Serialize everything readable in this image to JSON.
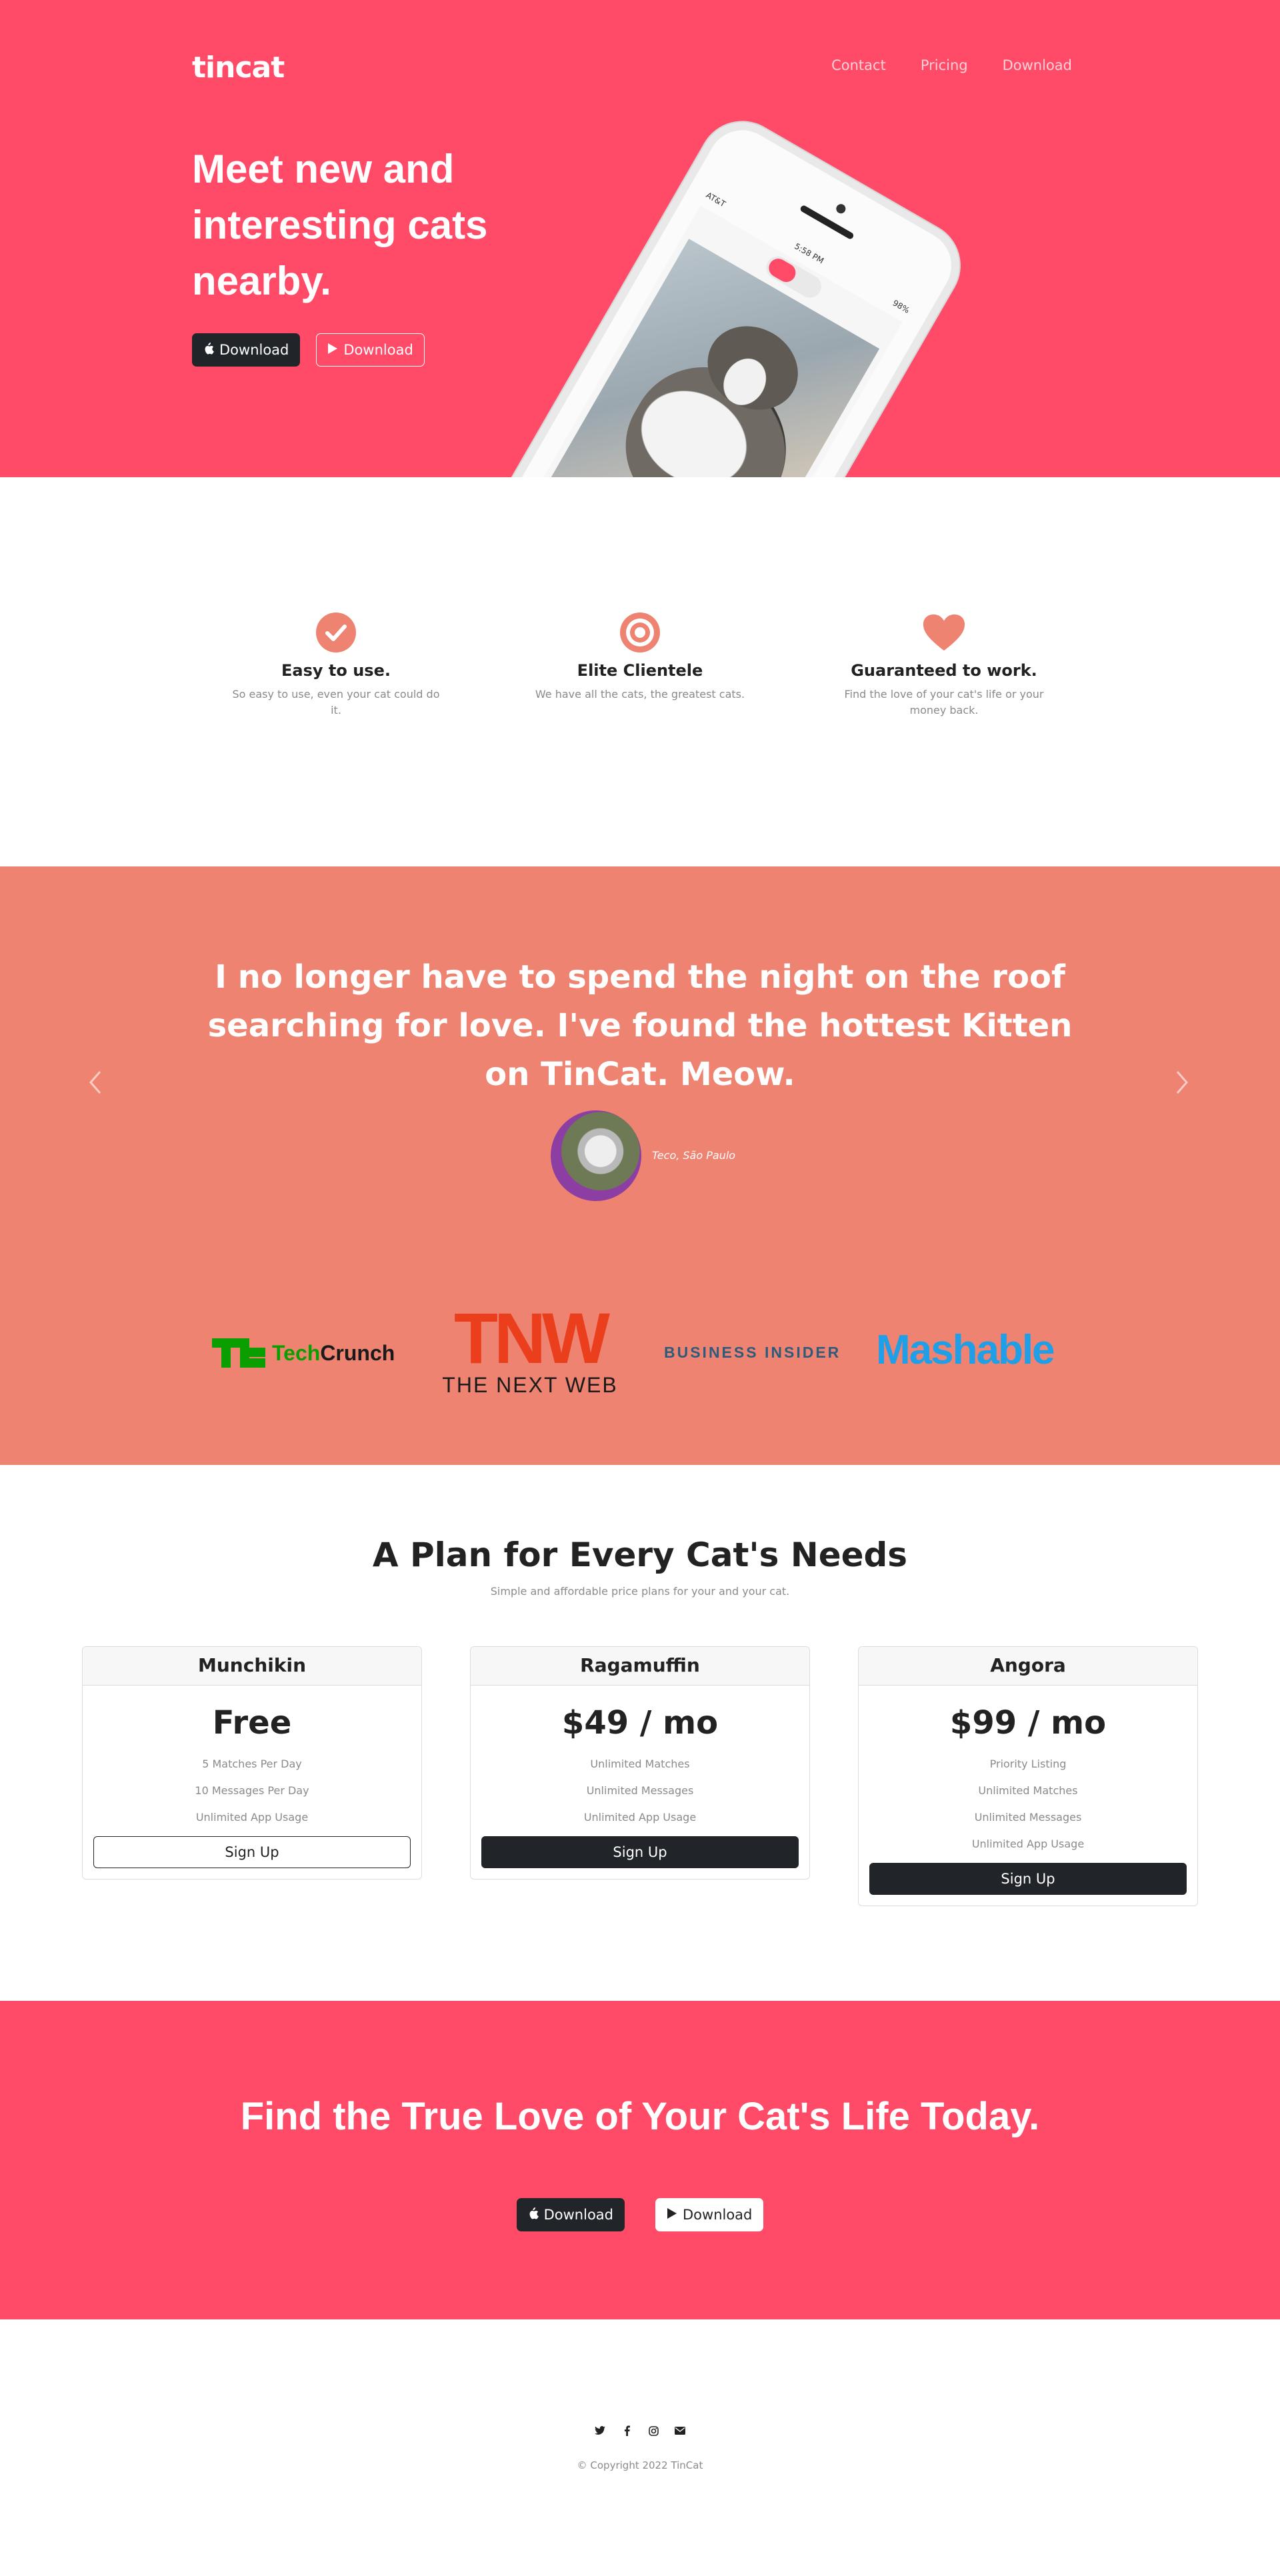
{
  "brand": "tincat",
  "nav": [
    "Contact",
    "Pricing",
    "Download"
  ],
  "hero": {
    "title": "Meet new and interesting cats nearby.",
    "buttons": [
      "Download",
      "Download"
    ]
  },
  "phone": {
    "carrier": "AT&T",
    "time": "5:58 PM",
    "battery": "98%"
  },
  "features": [
    {
      "icon": "check-circle-icon",
      "title": "Easy to use.",
      "text": "So easy to use, even your cat could do it."
    },
    {
      "icon": "target-icon",
      "title": "Elite Clientele",
      "text": "We have all the cats, the greatest cats."
    },
    {
      "icon": "heart-icon",
      "title": "Guaranteed to work.",
      "text": "Find the love of your cat's life or your money back."
    }
  ],
  "testimonial": {
    "quote": "I no longer have to spend the night on the roof searching for love. I've found the hottest Kitten on TinCat. Meow.",
    "author": "Teco, São Paulo"
  },
  "press": {
    "techcrunch": {
      "mark": "TC",
      "name_a": "Tech",
      "name_b": "Crunch"
    },
    "tnw": {
      "big": "TNW",
      "small": "THE NEXT WEB"
    },
    "business_insider": "BUSINESS INSIDER",
    "mashable": "Mashable"
  },
  "pricing": {
    "title": "A Plan for Every Cat's Needs",
    "subtitle": "Simple and affordable price plans for your and your cat.",
    "plans": [
      {
        "name": "Munchikin",
        "price": "Free",
        "features": [
          "5 Matches Per Day",
          "10 Messages Per Day",
          "Unlimited App Usage"
        ],
        "button": "Sign Up"
      },
      {
        "name": "Ragamuffin",
        "price": "$49 / mo",
        "features": [
          "Unlimited Matches",
          "Unlimited Messages",
          "Unlimited App Usage"
        ],
        "button": "Sign Up"
      },
      {
        "name": "Angora",
        "price": "$99 / mo",
        "features": [
          "Priority Listing",
          "Unlimited Matches",
          "Unlimited Messages",
          "Unlimited App Usage"
        ],
        "button": "Sign Up"
      }
    ]
  },
  "cta": {
    "title": "Find the True Love of Your Cat's Life Today.",
    "buttons": [
      "Download",
      "Download"
    ]
  },
  "footer": {
    "social": [
      "twitter-icon",
      "facebook-icon",
      "instagram-icon",
      "envelope-icon"
    ],
    "copyright": "© Copyright 2022 TinCat"
  },
  "colors": {
    "hero_bg": "#ff4b67",
    "accent": "#ef8371",
    "dark_button": "#212529"
  }
}
